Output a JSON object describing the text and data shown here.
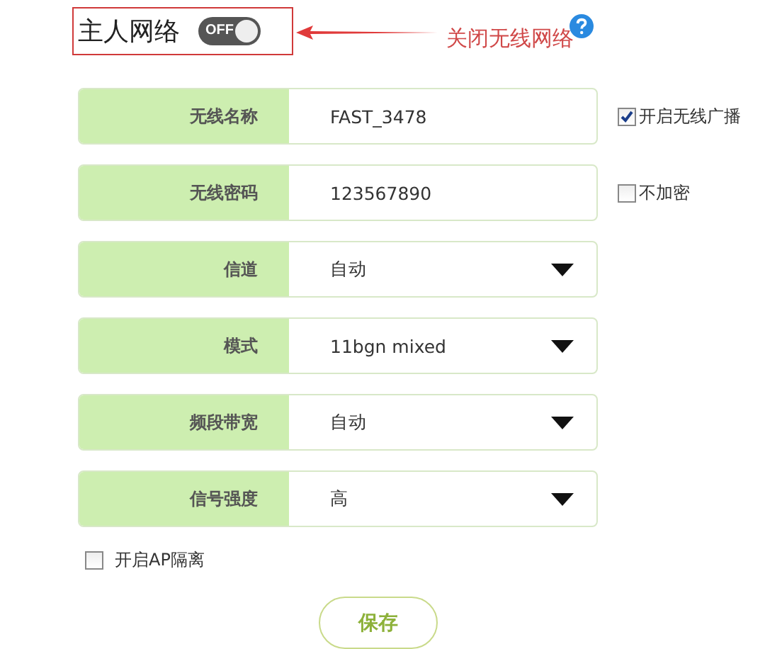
{
  "header": {
    "title": "主人网络",
    "toggle": {
      "label": "OFF",
      "on": false
    }
  },
  "annotation": {
    "text": "关闭无线网络"
  },
  "fields": [
    {
      "kind": "text",
      "label": "无线名称",
      "value": "FAST_3478",
      "option": {
        "label": "开启无线广播",
        "checked": true
      }
    },
    {
      "kind": "text",
      "label": "无线密码",
      "value": "123567890",
      "option": {
        "label": "不加密",
        "checked": false
      }
    },
    {
      "kind": "select",
      "label": "信道",
      "value": "自动"
    },
    {
      "kind": "select",
      "label": "模式",
      "value": "11bgn mixed"
    },
    {
      "kind": "select",
      "label": "频段带宽",
      "value": "自动"
    },
    {
      "kind": "select",
      "label": "信号强度",
      "value": "高"
    }
  ],
  "ap_isolation": {
    "label": "开启AP隔离",
    "checked": false
  },
  "buttons": [
    {
      "label": "保存"
    }
  ]
}
